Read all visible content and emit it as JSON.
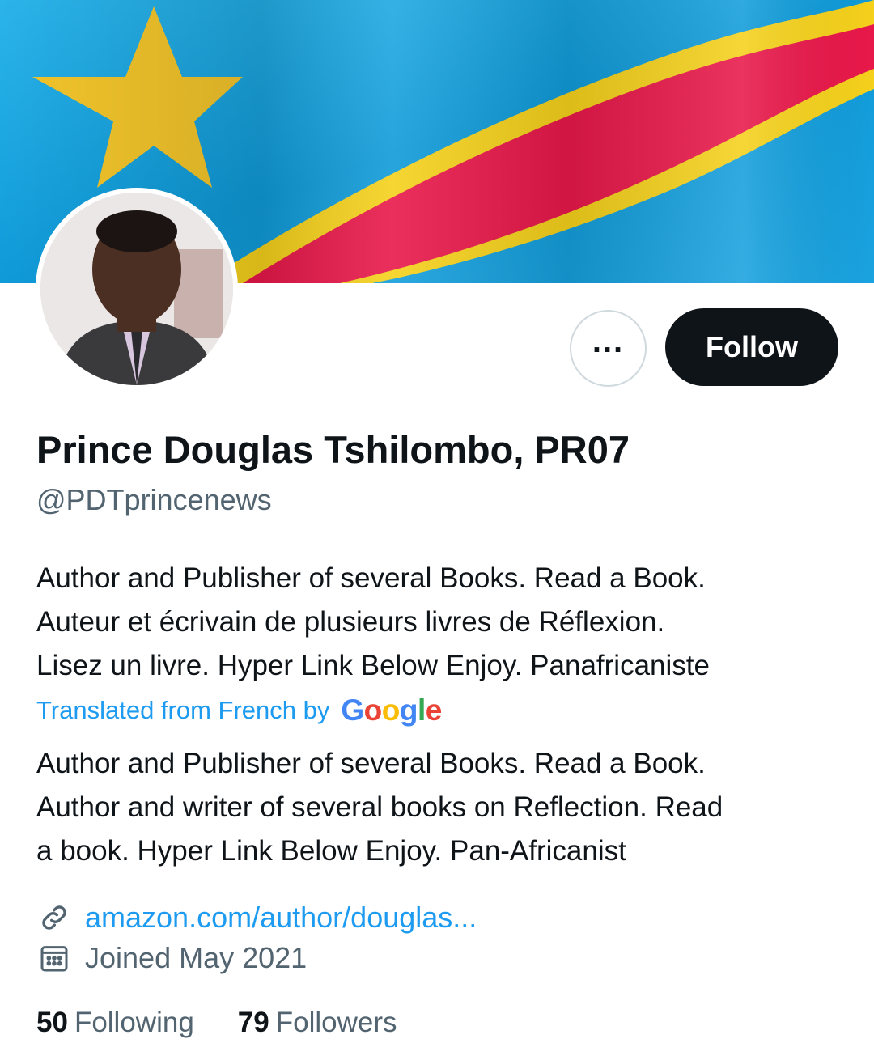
{
  "profile": {
    "name": "Prince Douglas Tshilombo, PR07",
    "handle": "@PDTprincenews",
    "bio_original": [
      "Author and Publisher of several Books. Read a Book.",
      "Auteur et écrivain de plusieurs livres de Réflexion.",
      "Lisez un livre. Hyper Link Below Enjoy. Panafricaniste"
    ],
    "translated_label": "Translated from French by",
    "translator_brand": [
      "G",
      "o",
      "o",
      "g",
      "l",
      "e"
    ],
    "bio_translated": [
      "Author and Publisher of several Books. Read a Book.",
      "Author and writer of several books on Reflection. Read",
      "a book. Hyper Link Below Enjoy. Pan-Africanist"
    ],
    "website": "amazon.com/author/douglas...",
    "joined": "Joined May 2021",
    "following_count": "50",
    "following_label": "Following",
    "followers_count": "79",
    "followers_label": "Followers"
  },
  "actions": {
    "more_label": "...",
    "follow_label": "Follow"
  },
  "icons": {
    "more": "more-icon",
    "link": "link-icon",
    "calendar": "calendar-icon"
  },
  "colors": {
    "accent": "#1d9bf0",
    "text": "#0f1419",
    "secondary": "#536471",
    "follow_bg": "#0f1419",
    "flag_blue": "#1aa3e0",
    "flag_red": "#e8184a",
    "flag_yellow": "#f5d11c"
  }
}
